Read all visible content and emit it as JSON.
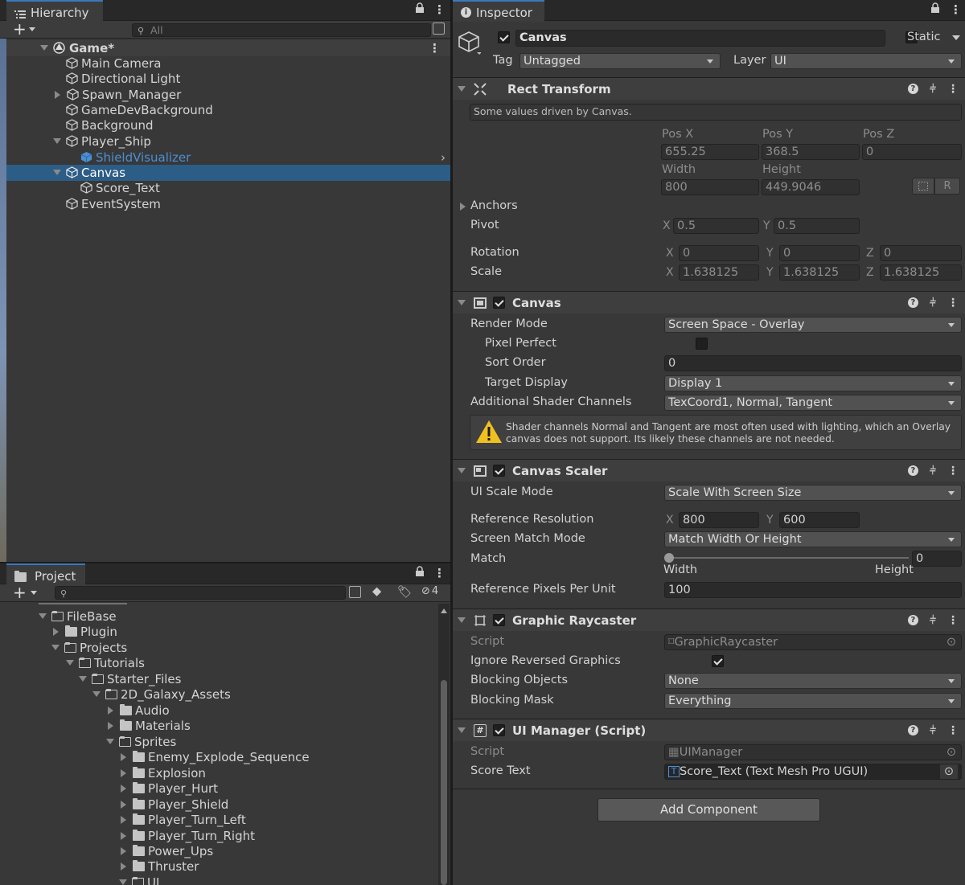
{
  "hierarchy": {
    "tab_label": "Hierarchy",
    "search_placeholder": "All",
    "scene_name": "Game*",
    "items": [
      {
        "label": "Main Camera"
      },
      {
        "label": "Directional Light"
      },
      {
        "label": "Spawn_Manager"
      },
      {
        "label": "GameDevBackground"
      },
      {
        "label": "Background"
      },
      {
        "label": "Player_Ship"
      },
      {
        "label": "ShieldVisualizer"
      },
      {
        "label": "Canvas"
      },
      {
        "label": "Score_Text"
      },
      {
        "label": "EventSystem"
      }
    ]
  },
  "project": {
    "tab_label": "Project",
    "hidden_count": "4",
    "items": [
      {
        "label": "FileBase"
      },
      {
        "label": "Plugin"
      },
      {
        "label": "Projects"
      },
      {
        "label": "Tutorials"
      },
      {
        "label": "Starter_Files"
      },
      {
        "label": "2D_Galaxy_Assets"
      },
      {
        "label": "Audio"
      },
      {
        "label": "Materials"
      },
      {
        "label": "Sprites"
      },
      {
        "label": "Enemy_Explode_Sequence"
      },
      {
        "label": "Explosion"
      },
      {
        "label": "Player_Hurt"
      },
      {
        "label": "Player_Shield"
      },
      {
        "label": "Player_Turn_Left"
      },
      {
        "label": "Player_Turn_Right"
      },
      {
        "label": "Power_Ups"
      },
      {
        "label": "Thruster"
      },
      {
        "label": "UI"
      }
    ]
  },
  "inspector": {
    "tab_label": "Inspector",
    "object_name": "Canvas",
    "static_label": "Static",
    "tag_label": "Tag",
    "tag_value": "Untagged",
    "layer_label": "Layer",
    "layer_value": "UI",
    "rect_transform": {
      "title": "Rect Transform",
      "note": "Some values driven by Canvas.",
      "pos_x_label": "Pos X",
      "pos_y_label": "Pos Y",
      "pos_z_label": "Pos Z",
      "pos_x": "655.25",
      "pos_y": "368.5",
      "pos_z": "0",
      "width_label": "Width",
      "height_label": "Height",
      "width": "800",
      "height": "449.9046",
      "anchors_label": "Anchors",
      "pivot_label": "Pivot",
      "pivot_x": "0.5",
      "pivot_y": "0.5",
      "rotation_label": "Rotation",
      "rot_x": "0",
      "rot_y": "0",
      "rot_z": "0",
      "scale_label": "Scale",
      "scale_x": "1.638125",
      "scale_y": "1.638125",
      "scale_z": "1.638125",
      "axis_x": "X",
      "axis_y": "Y",
      "axis_z": "Z",
      "r_button": "R"
    },
    "canvas": {
      "title": "Canvas",
      "render_mode_label": "Render Mode",
      "render_mode": "Screen Space - Overlay",
      "pixel_perfect_label": "Pixel Perfect",
      "sort_order_label": "Sort Order",
      "sort_order": "0",
      "target_display_label": "Target Display",
      "target_display": "Display 1",
      "shader_channels_label": "Additional Shader Channels",
      "shader_channels": "TexCoord1, Normal, Tangent",
      "warning_line1": "Shader channels Normal and Tangent are most often used with lighting, which an Overlay",
      "warning_line2": "canvas does not support. Its likely these channels are not needed."
    },
    "canvas_scaler": {
      "title": "Canvas Scaler",
      "ui_scale_mode_label": "UI Scale Mode",
      "ui_scale_mode": "Scale With Screen Size",
      "ref_res_label": "Reference Resolution",
      "ref_x": "800",
      "ref_y": "600",
      "match_mode_label": "Screen Match Mode",
      "match_mode": "Match Width Or Height",
      "match_label": "Match",
      "match_value": "0",
      "width_label": "Width",
      "height_label": "Height",
      "ppu_label": "Reference Pixels Per Unit",
      "ppu": "100"
    },
    "graphic_raycaster": {
      "title": "Graphic Raycaster",
      "script_label": "Script",
      "script": "GraphicRaycaster",
      "ignore_label": "Ignore Reversed Graphics",
      "blocking_objects_label": "Blocking Objects",
      "blocking_objects": "None",
      "blocking_mask_label": "Blocking Mask",
      "blocking_mask": "Everything"
    },
    "ui_manager": {
      "title": "UI Manager (Script)",
      "script_label": "Script",
      "script": "UIManager",
      "score_text_label": "Score Text",
      "score_text": "Score_Text (Text Mesh Pro UGUI)"
    },
    "add_component": "Add Component"
  },
  "colors": {
    "selection": "#2c5d87",
    "accent": "#3a79bb",
    "prefab_blue": "#4a8fd4"
  }
}
